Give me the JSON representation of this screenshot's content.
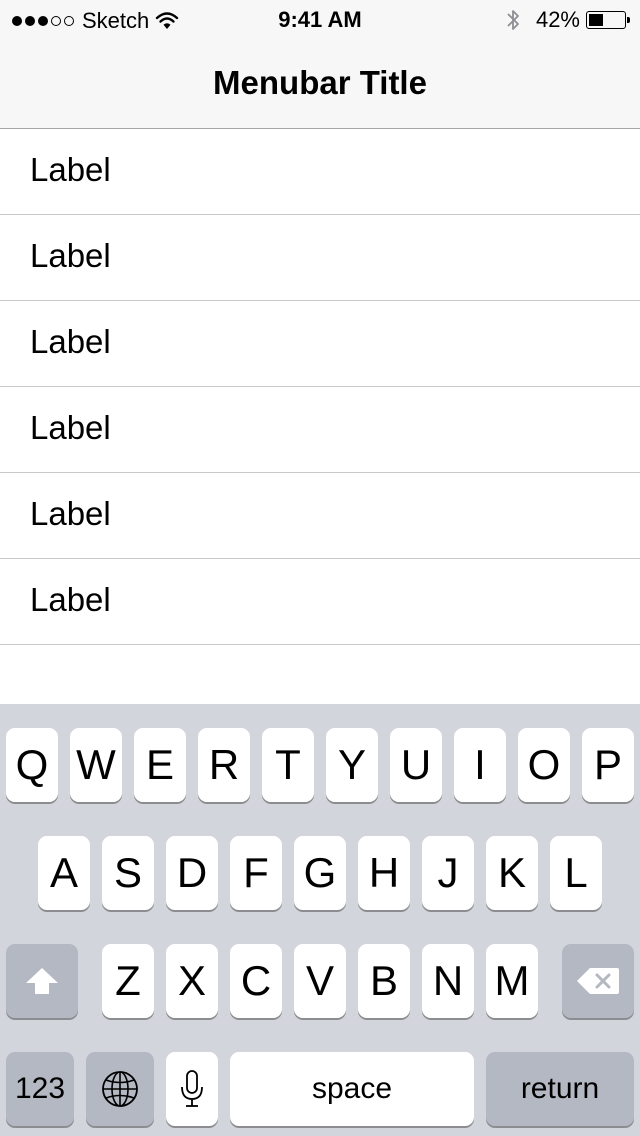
{
  "status_bar": {
    "signal_dots_filled": 3,
    "signal_dots_total": 5,
    "carrier": "Sketch",
    "time": "9:41 AM",
    "battery_percent_text": "42%",
    "battery_level": 0.42,
    "icons": [
      "wifi-icon",
      "bluetooth-icon",
      "battery-icon"
    ]
  },
  "navbar": {
    "title": "Menubar Title"
  },
  "list": {
    "rows": [
      {
        "label": "Label"
      },
      {
        "label": "Label"
      },
      {
        "label": "Label"
      },
      {
        "label": "Label"
      },
      {
        "label": "Label"
      },
      {
        "label": "Label"
      }
    ]
  },
  "keyboard": {
    "row1": [
      "Q",
      "W",
      "E",
      "R",
      "T",
      "Y",
      "U",
      "I",
      "O",
      "P"
    ],
    "row2": [
      "A",
      "S",
      "D",
      "F",
      "G",
      "H",
      "J",
      "K",
      "L"
    ],
    "row3": [
      "Z",
      "X",
      "C",
      "V",
      "B",
      "N",
      "M"
    ],
    "numbers_label": "123",
    "space_label": "space",
    "return_label": "return",
    "icons": [
      "shift-icon",
      "backspace-icon",
      "globe-icon",
      "microphone-icon"
    ],
    "colors": {
      "background": "#d2d5db",
      "key": "#ffffff",
      "special_key": "#b3b8c2"
    }
  }
}
